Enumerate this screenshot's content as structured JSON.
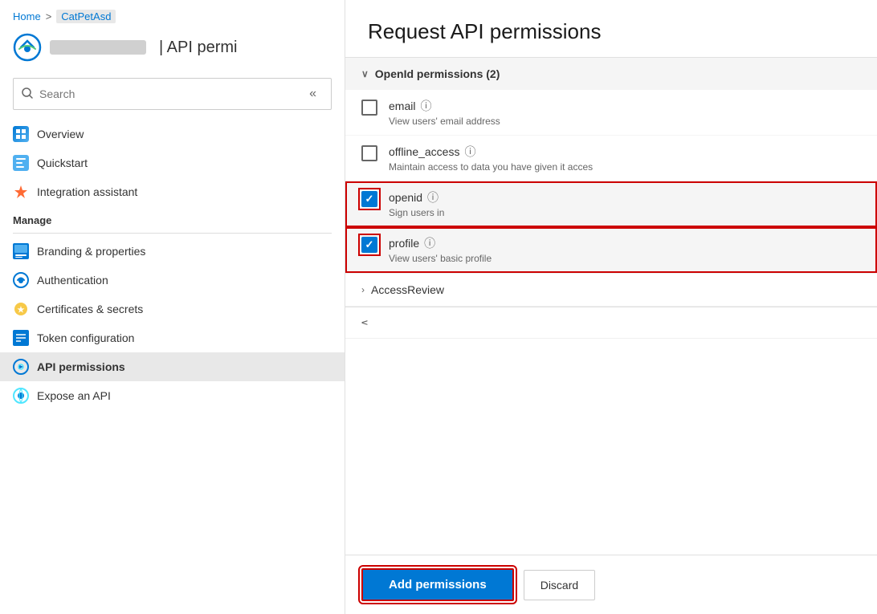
{
  "breadcrumb": {
    "home": "Home",
    "separator": ">",
    "app_name": "CatPetAsd"
  },
  "app_header": {
    "title": "| API permi",
    "app_name_placeholder": "CatPetAsd"
  },
  "search": {
    "placeholder": "Search",
    "label": "Search"
  },
  "collapse_btn": "«",
  "nav": {
    "items": [
      {
        "label": "Overview",
        "icon": "grid-icon",
        "active": false
      },
      {
        "label": "Quickstart",
        "icon": "quickstart-icon",
        "active": false
      },
      {
        "label": "Integration assistant",
        "icon": "rocket-icon",
        "active": false
      }
    ],
    "manage_section": "Manage",
    "manage_items": [
      {
        "label": "Branding & properties",
        "icon": "branding-icon",
        "active": false
      },
      {
        "label": "Authentication",
        "icon": "auth-icon",
        "active": false
      },
      {
        "label": "Certificates & secrets",
        "icon": "certs-icon",
        "active": false
      },
      {
        "label": "Token configuration",
        "icon": "token-icon",
        "active": false
      },
      {
        "label": "API permissions",
        "icon": "api-icon",
        "active": true
      },
      {
        "label": "Expose an API",
        "icon": "expose-icon",
        "active": false
      }
    ]
  },
  "overlay": {
    "title": "Request API permissions",
    "openid_section": {
      "label": "OpenId permissions (2)",
      "expanded": true,
      "permissions": [
        {
          "name": "email",
          "description": "View users' email address",
          "checked": false,
          "highlighted": false
        },
        {
          "name": "offline_access",
          "description": "Maintain access to data you have given it acces",
          "checked": false,
          "highlighted": false
        },
        {
          "name": "openid",
          "description": "Sign users in",
          "checked": true,
          "highlighted": true
        },
        {
          "name": "profile",
          "description": "View users' basic profile",
          "checked": true,
          "highlighted": true
        }
      ]
    },
    "access_review": {
      "label": "AccessReview",
      "expanded": false
    },
    "collapsed_section": {
      "label": ""
    },
    "footer": {
      "add_btn": "Add permissions",
      "discard_btn": "Discard"
    }
  }
}
